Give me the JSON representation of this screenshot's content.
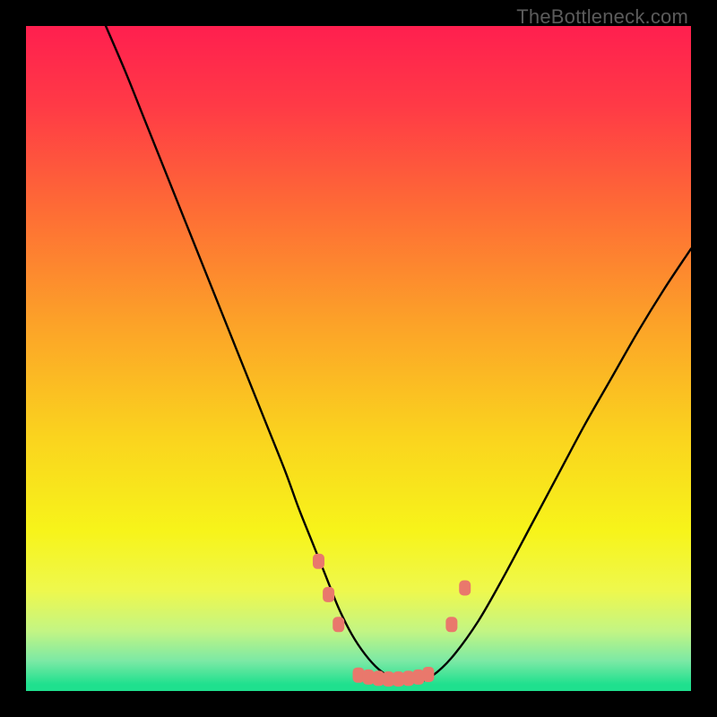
{
  "watermark": "TheBottleneck.com",
  "gradient": {
    "stops": [
      {
        "offset": 0.0,
        "color": "#ff1f4f"
      },
      {
        "offset": 0.12,
        "color": "#ff3a46"
      },
      {
        "offset": 0.28,
        "color": "#fe6d35"
      },
      {
        "offset": 0.45,
        "color": "#fca328"
      },
      {
        "offset": 0.62,
        "color": "#fad41e"
      },
      {
        "offset": 0.76,
        "color": "#f7f41a"
      },
      {
        "offset": 0.85,
        "color": "#eef84e"
      },
      {
        "offset": 0.91,
        "color": "#c3f584"
      },
      {
        "offset": 0.955,
        "color": "#7be9a5"
      },
      {
        "offset": 0.99,
        "color": "#1fe08e"
      },
      {
        "offset": 1.0,
        "color": "#1fe08e"
      }
    ]
  },
  "chart_data": {
    "type": "line",
    "title": "",
    "xlabel": "",
    "ylabel": "",
    "xlim": [
      0,
      100
    ],
    "ylim": [
      0,
      100
    ],
    "grid": false,
    "series": [
      {
        "name": "bottleneck-curve",
        "x": [
          12,
          15,
          18,
          21,
          24,
          27,
          30,
          33,
          36,
          39,
          41,
          43,
          45,
          47,
          49,
          51,
          53,
          55,
          57,
          59,
          61,
          64,
          68,
          72,
          76,
          80,
          84,
          88,
          92,
          96,
          100
        ],
        "y": [
          100,
          93,
          85.5,
          78,
          70.5,
          63,
          55.5,
          48,
          40.5,
          33,
          27.5,
          22.5,
          17.5,
          12.5,
          8.5,
          5.5,
          3.3,
          2.0,
          1.4,
          1.4,
          2.2,
          5.0,
          10.5,
          17.5,
          25.0,
          32.5,
          40.0,
          47.0,
          54.0,
          60.5,
          66.5
        ]
      }
    ],
    "markers": {
      "name": "highlighted-points",
      "color": "#e9786c",
      "points": [
        {
          "x": 44.0,
          "y": 19.5
        },
        {
          "x": 45.5,
          "y": 14.5
        },
        {
          "x": 47.0,
          "y": 10.0
        },
        {
          "x": 50.0,
          "y": 2.4
        },
        {
          "x": 51.5,
          "y": 2.1
        },
        {
          "x": 53.0,
          "y": 1.9
        },
        {
          "x": 54.5,
          "y": 1.8
        },
        {
          "x": 56.0,
          "y": 1.8
        },
        {
          "x": 57.5,
          "y": 1.9
        },
        {
          "x": 59.0,
          "y": 2.1
        },
        {
          "x": 60.5,
          "y": 2.5
        },
        {
          "x": 64.0,
          "y": 10.0
        },
        {
          "x": 66.0,
          "y": 15.5
        }
      ]
    }
  }
}
